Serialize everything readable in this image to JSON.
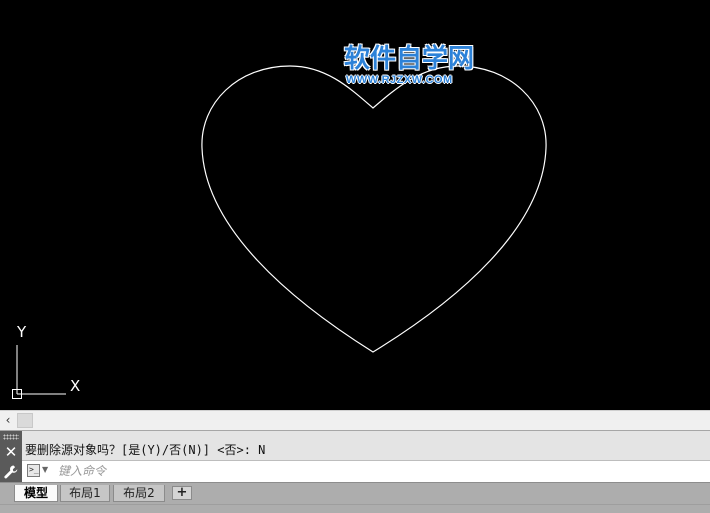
{
  "watermark": {
    "title": "软件自学网",
    "url": "WWW.RJZXW.COM"
  },
  "ucs": {
    "y_label": "Y",
    "x_label": "X"
  },
  "scrollbar": {
    "left_arrow": "‹"
  },
  "command_panel": {
    "close_symbol": "✕",
    "history_line": "要删除源对象吗？[是(Y)/否(N)] <否>: N",
    "prompt_symbol": ">_",
    "input_value": "",
    "input_placeholder": "键入命令"
  },
  "layout_tabs": {
    "tabs": [
      {
        "label": "模型",
        "active": true
      },
      {
        "label": "布局1",
        "active": false
      },
      {
        "label": "布局2",
        "active": false
      }
    ],
    "add_label": "+"
  },
  "colors": {
    "canvas_background": "#000000",
    "drawing_stroke": "#ffffff",
    "watermark_blue": "#2d82d8"
  },
  "icons": {
    "close": "close-icon",
    "wrench": "wrench-icon",
    "prompt": "command-prompt-icon",
    "dropdown": "chevron-down-icon",
    "scroll_left": "chevron-left-icon"
  }
}
